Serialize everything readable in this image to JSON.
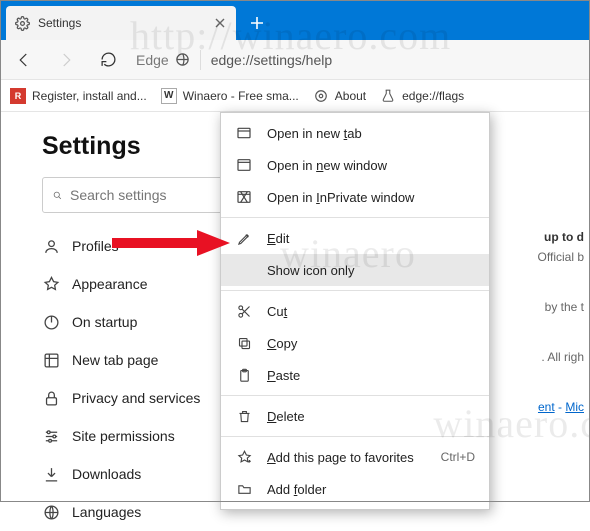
{
  "tab": {
    "title": "Settings"
  },
  "address": {
    "prefix": "Edge",
    "url": "edge://settings/help"
  },
  "bookmarks": [
    {
      "label": "Register, install and..."
    },
    {
      "label": "Winaero - Free sma..."
    },
    {
      "label": "About"
    },
    {
      "label": "edge://flags"
    }
  ],
  "page": {
    "title": "Settings",
    "search_placeholder": "Search settings"
  },
  "sidebar": [
    {
      "label": "Profiles"
    },
    {
      "label": "Appearance"
    },
    {
      "label": "On startup"
    },
    {
      "label": "New tab page"
    },
    {
      "label": "Privacy and services"
    },
    {
      "label": "Site permissions"
    },
    {
      "label": "Downloads"
    },
    {
      "label": "Languages"
    }
  ],
  "right": {
    "a": "up to d",
    "b": "Official b",
    "c": "by the t",
    "d": ". All righ",
    "e1": "ent",
    "e2": " - ",
    "e3": "Mic"
  },
  "ctx": {
    "open_tab_pre": "Open in new ",
    "open_tab_u": "t",
    "open_tab_post": "ab",
    "open_win_pre": "Open in ",
    "open_win_u": "n",
    "open_win_post": "ew window",
    "open_inp_pre": "Open in ",
    "open_inp_u": "I",
    "open_inp_post": "nPrivate window",
    "edit_u": "E",
    "edit_post": "dit",
    "show_icon": "Show icon only",
    "cut_pre": "Cu",
    "cut_u": "t",
    "copy_u": "C",
    "copy_post": "opy",
    "paste_u": "P",
    "paste_post": "aste",
    "delete_u": "D",
    "delete_post": "elete",
    "add_fav_u": "A",
    "add_fav_post": "dd this page to favorites",
    "add_fav_sc": "Ctrl+D",
    "add_folder_pre": "Add ",
    "add_folder_u": "f",
    "add_folder_post": "older"
  }
}
